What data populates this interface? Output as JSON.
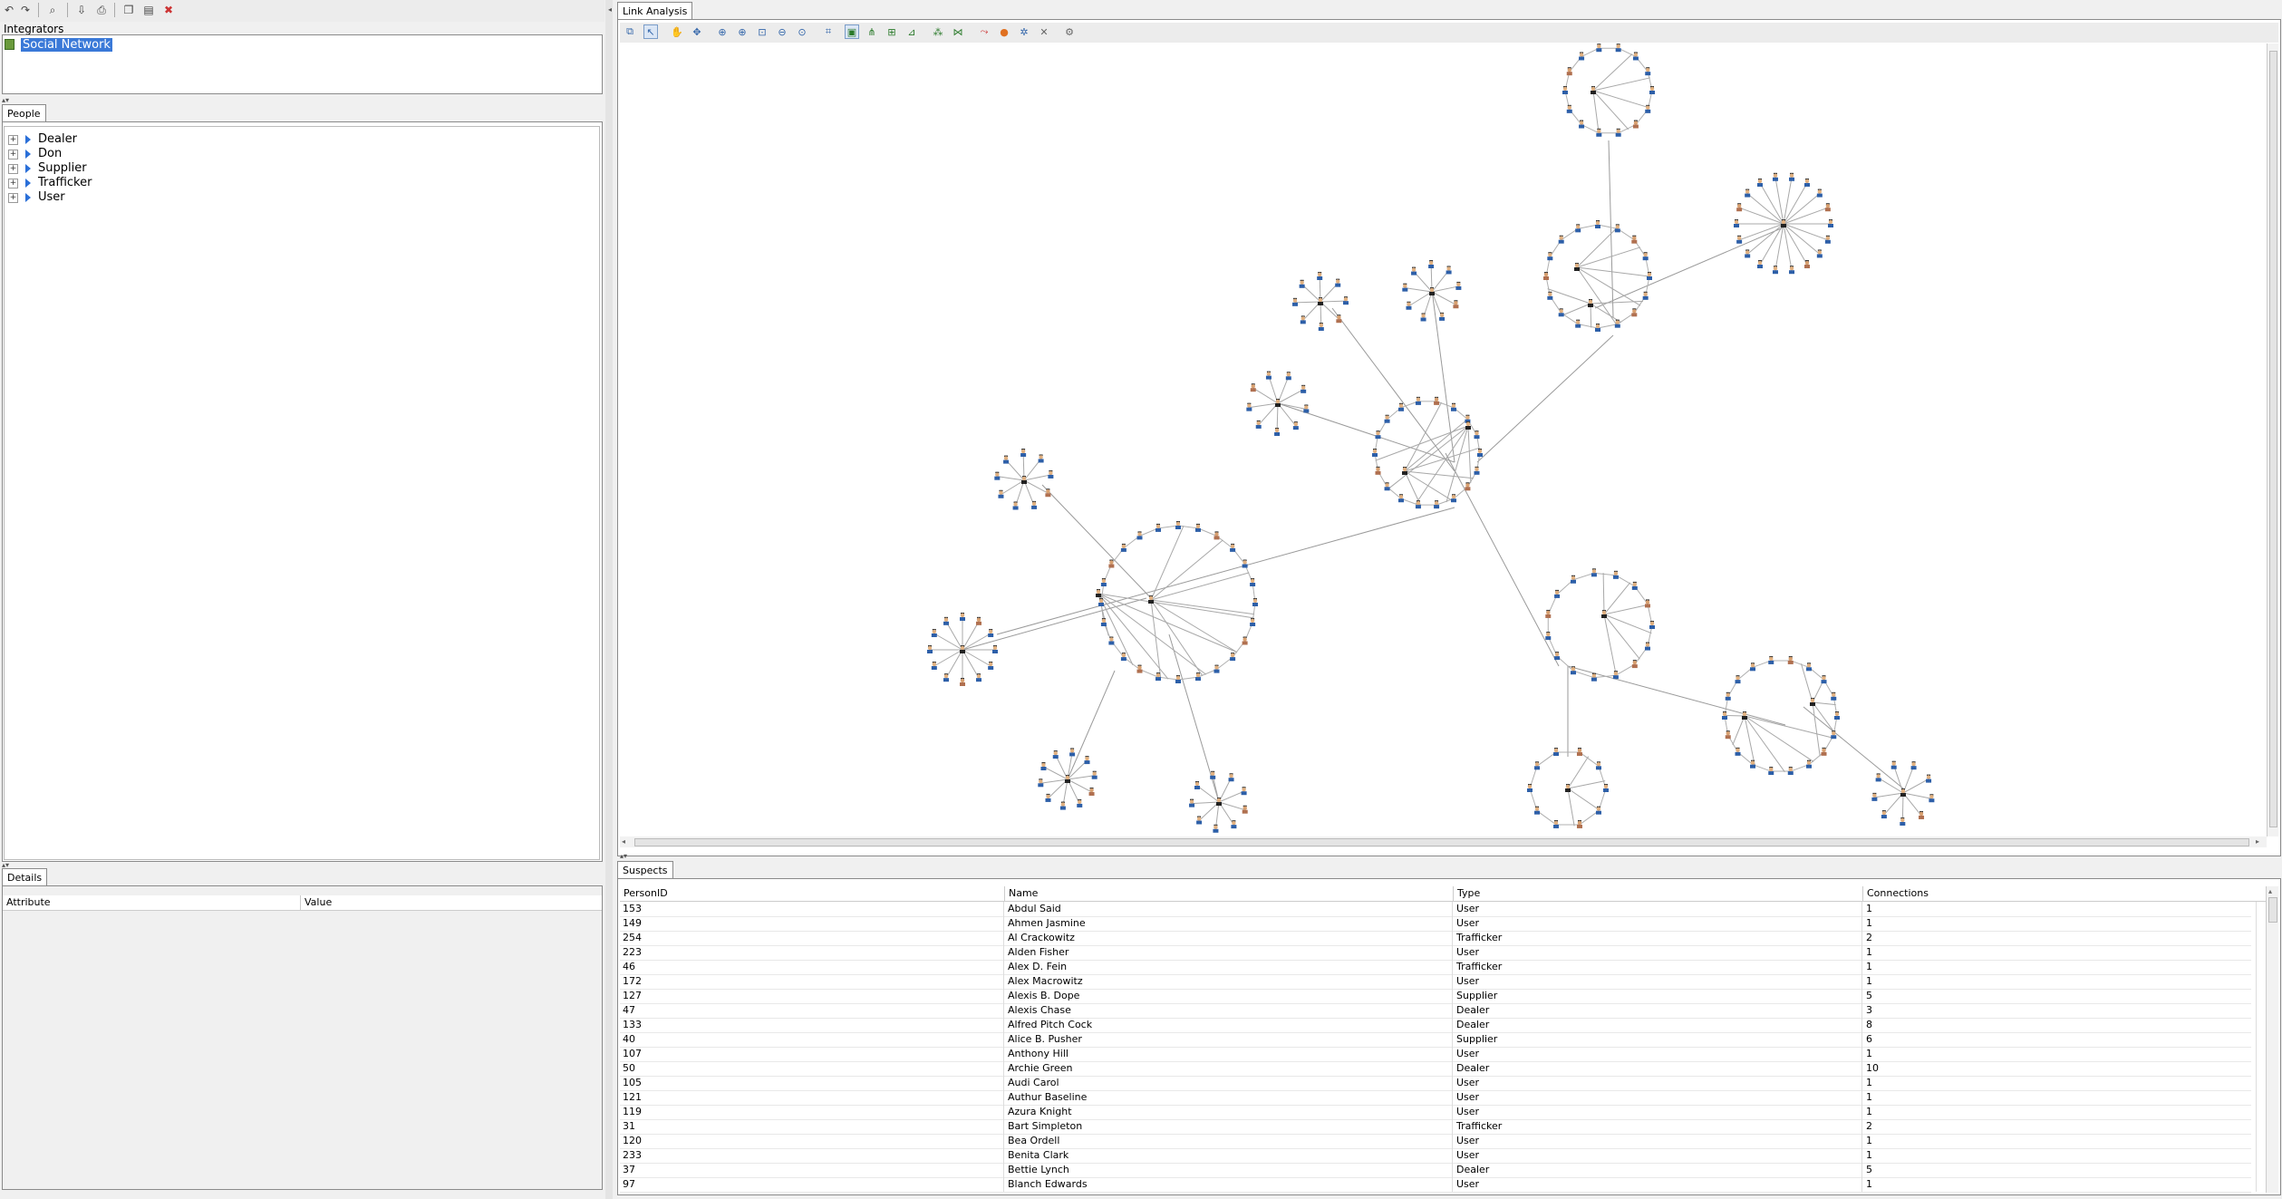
{
  "left_toolbar": {
    "icons": [
      "undo-icon",
      "redo-icon",
      "search-user-icon",
      "import-icon",
      "print-icon",
      "copy-icon",
      "paste-icon",
      "delete-icon"
    ]
  },
  "integrators": {
    "label": "Integrators",
    "items": [
      {
        "label": "Social Network"
      }
    ]
  },
  "people": {
    "tab": "People",
    "items": [
      {
        "label": "Dealer"
      },
      {
        "label": "Don"
      },
      {
        "label": "Supplier"
      },
      {
        "label": "Trafficker"
      },
      {
        "label": "User"
      }
    ]
  },
  "details": {
    "tab": "Details",
    "columns": {
      "attribute": "Attribute",
      "value": "Value"
    }
  },
  "link_analysis": {
    "tab": "Link Analysis",
    "toolbar_icons": [
      "copy-graph-icon",
      "select-icon",
      "pan-hand-icon",
      "move-icon",
      "zoom-icon",
      "zoom-in-icon",
      "zoom-fit-icon",
      "zoom-out-icon",
      "zoom-reset-icon",
      "layout-icon",
      "auto-layout-icon",
      "tree-layout-icon",
      "grid-layout-icon",
      "hierarchy-layout-icon",
      "cluster-layout-icon",
      "organic-layout-icon",
      "link-icon",
      "node-icon",
      "expand-icon",
      "collapse-icon",
      "settings-icon"
    ]
  },
  "suspects": {
    "tab": "Suspects",
    "columns": {
      "id": "PersonID",
      "name": "Name",
      "type": "Type",
      "connections": "Connections"
    },
    "rows": [
      {
        "id": "153",
        "name": "Abdul Said",
        "type": "User",
        "connections": "1"
      },
      {
        "id": "149",
        "name": "Ahmen Jasmine",
        "type": "User",
        "connections": "1"
      },
      {
        "id": "254",
        "name": "Al Crackowitz",
        "type": "Trafficker",
        "connections": "2"
      },
      {
        "id": "223",
        "name": "Alden Fisher",
        "type": "User",
        "connections": "1"
      },
      {
        "id": "46",
        "name": "Alex D. Fein",
        "type": "Trafficker",
        "connections": "1"
      },
      {
        "id": "172",
        "name": "Alex Macrowitz",
        "type": "User",
        "connections": "1"
      },
      {
        "id": "127",
        "name": "Alexis B. Dope",
        "type": "Supplier",
        "connections": "5"
      },
      {
        "id": "47",
        "name": "Alexis Chase",
        "type": "Dealer",
        "connections": "3"
      },
      {
        "id": "133",
        "name": "Alfred Pitch Cock",
        "type": "Dealer",
        "connections": "8"
      },
      {
        "id": "40",
        "name": "Alice B. Pusher",
        "type": "Supplier",
        "connections": "6"
      },
      {
        "id": "107",
        "name": "Anthony Hill",
        "type": "User",
        "connections": "1"
      },
      {
        "id": "50",
        "name": "Archie Green",
        "type": "Dealer",
        "connections": "10"
      },
      {
        "id": "105",
        "name": "Audi Carol",
        "type": "User",
        "connections": "1"
      },
      {
        "id": "121",
        "name": "Authur Baseline",
        "type": "User",
        "connections": "1"
      },
      {
        "id": "119",
        "name": "Azura Knight",
        "type": "User",
        "connections": "1"
      },
      {
        "id": "31",
        "name": "Bart Simpleton",
        "type": "Trafficker",
        "connections": "2"
      },
      {
        "id": "120",
        "name": "Bea Ordell",
        "type": "User",
        "connections": "1"
      },
      {
        "id": "233",
        "name": "Benita Clark",
        "type": "User",
        "connections": "1"
      },
      {
        "id": "37",
        "name": "Bettie Lynch",
        "type": "Dealer",
        "connections": "5"
      },
      {
        "id": "97",
        "name": "Blanch Edwards",
        "type": "User",
        "connections": "1"
      }
    ]
  }
}
